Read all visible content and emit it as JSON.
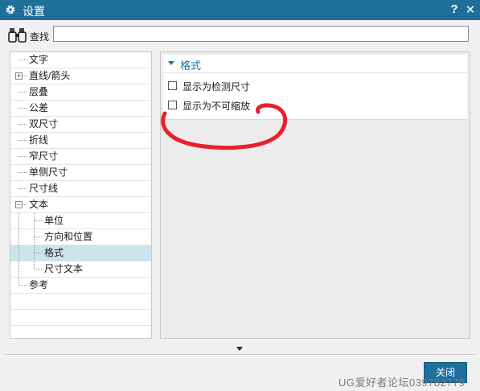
{
  "window": {
    "title": "设置",
    "help_label": "?",
    "close_label": "✕"
  },
  "search": {
    "label": "查找",
    "value": "",
    "placeholder": ""
  },
  "tree": {
    "items": [
      {
        "label": "文字"
      },
      {
        "label": "直线/箭头",
        "expander": "+"
      },
      {
        "label": "层叠"
      },
      {
        "label": "公差"
      },
      {
        "label": "双尺寸"
      },
      {
        "label": "折线"
      },
      {
        "label": "窄尺寸"
      },
      {
        "label": "单侧尺寸"
      },
      {
        "label": "尺寸线"
      },
      {
        "label": "文本",
        "expander": "−"
      },
      {
        "label": "单位"
      },
      {
        "label": "方向和位置"
      },
      {
        "label": "格式",
        "selected": true
      },
      {
        "label": "尺寸文本"
      },
      {
        "label": "参考"
      }
    ]
  },
  "group": {
    "title": "格式",
    "options": [
      {
        "label": "显示为检测尺寸",
        "checked": false
      },
      {
        "label": "显示为不可缩放",
        "checked": false
      }
    ]
  },
  "footer": {
    "close_label": "关闭",
    "watermark": "UG爱好者论坛039782779"
  },
  "colors": {
    "titlebar": "#1f6f9b",
    "annotation": "#e8202a",
    "selection": "#cde3ee"
  }
}
